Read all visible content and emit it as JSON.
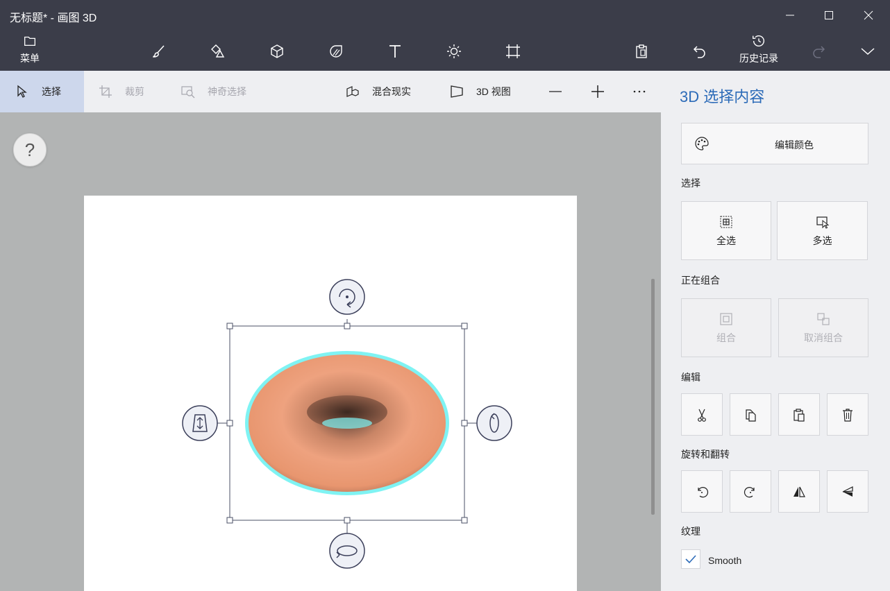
{
  "window": {
    "title": "无标题* - 画图 3D"
  },
  "toolbar": {
    "menu_label": "菜单",
    "history_label": "历史记录",
    "tools": [
      "brushes-icon",
      "2d-shapes-icon",
      "3d-shapes-icon",
      "stickers-icon",
      "text-icon",
      "effects-icon",
      "canvas-icon"
    ]
  },
  "subtoolbar": {
    "select_label": "选择",
    "crop_label": "裁剪",
    "magic_select_label": "神奇选择",
    "mixed_reality_label": "混合现实",
    "view3d_label": "3D 视图"
  },
  "workspace": {
    "help_label": "?"
  },
  "panel": {
    "title": "3D 选择内容",
    "edit_color_label": "编辑颜色",
    "select_section": "选择",
    "select_all_label": "全选",
    "multi_select_label": "多选",
    "grouping_section": "正在组合",
    "group_label": "组合",
    "ungroup_label": "取消组合",
    "edit_section": "编辑",
    "rotate_flip_section": "旋转和翻转",
    "texture_section": "纹理",
    "smooth_label": "Smooth",
    "smooth_checked": true
  },
  "colors": {
    "accent": "#2c6bb8",
    "titlebar": "#3b3d49",
    "torus": "#e9a07e",
    "highlight": "#7ff3f3"
  }
}
